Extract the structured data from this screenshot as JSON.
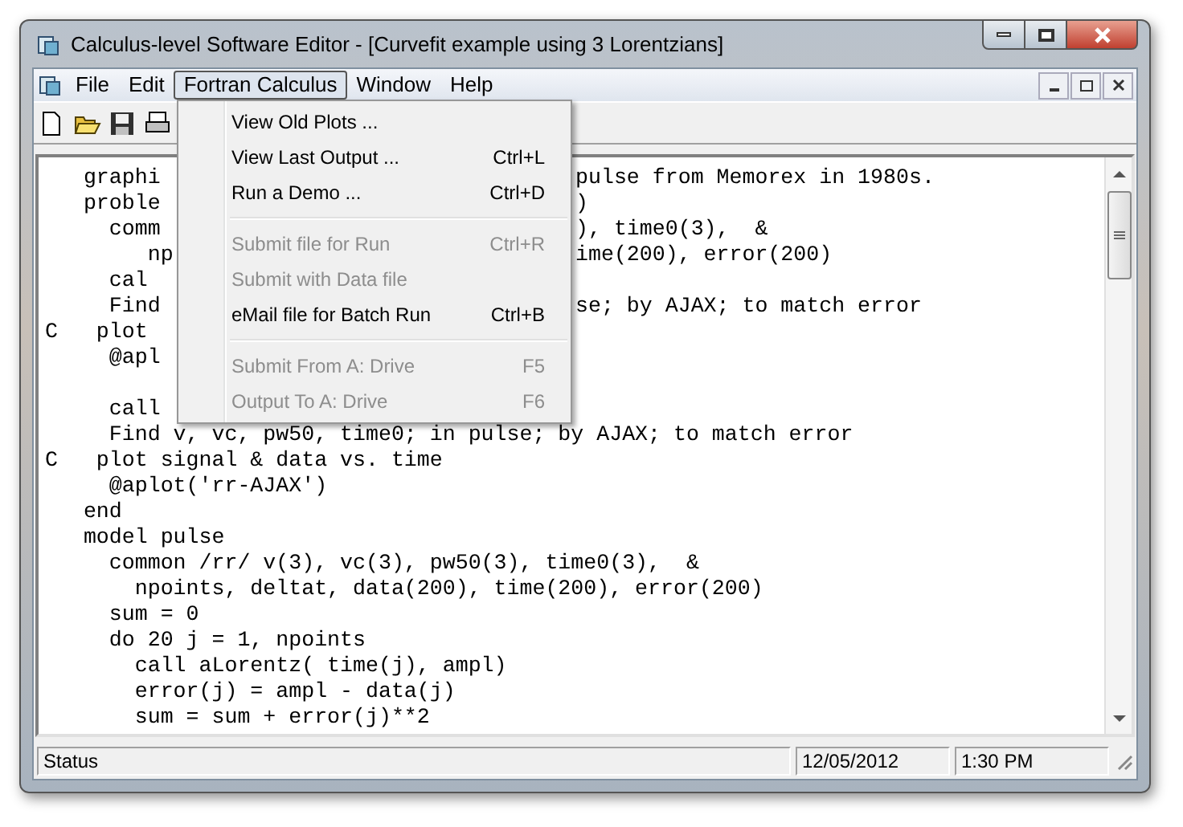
{
  "window": {
    "title": "Calculus-level Software Editor - [Curvefit example using 3 Lorentzians]"
  },
  "menubar": {
    "items": [
      {
        "label": "File",
        "selected": false
      },
      {
        "label": "Edit",
        "selected": false
      },
      {
        "label": "Fortran Calculus",
        "selected": true
      },
      {
        "label": "Window",
        "selected": false
      },
      {
        "label": "Help",
        "selected": false
      }
    ]
  },
  "dropdown": {
    "items": [
      {
        "kind": "item",
        "label": "View Old Plots ...",
        "disabled": false
      },
      {
        "kind": "item",
        "label": "View Last Output ...",
        "shortcut": "Ctrl+L",
        "disabled": false
      },
      {
        "kind": "item",
        "label": "Run a Demo ...",
        "shortcut": "Ctrl+D",
        "disabled": false
      },
      {
        "kind": "separator"
      },
      {
        "kind": "item",
        "label": "Submit file for Run",
        "shortcut": "Ctrl+R",
        "disabled": true
      },
      {
        "kind": "item",
        "label": "Submit with Data file",
        "disabled": true
      },
      {
        "kind": "item",
        "label": "eMail file for Batch Run",
        "shortcut": "Ctrl+B",
        "disabled": false
      },
      {
        "kind": "separator"
      },
      {
        "kind": "item",
        "label": "Submit From A: Drive",
        "shortcut": "F5",
        "disabled": true
      },
      {
        "kind": "item",
        "label": "Output To A: Drive",
        "shortcut": "F6",
        "disabled": true
      }
    ]
  },
  "editor": {
    "lines": [
      {
        "kind": "code",
        "left": "   graphi",
        "right": "pulse from Memorex in 1980s."
      },
      {
        "kind": "code",
        "left": "   proble",
        "right": ")"
      },
      {
        "kind": "code",
        "left": "     comm",
        "right": "), time0(3),  &"
      },
      {
        "kind": "code",
        "left": "        np",
        "right": "ime(200), error(200)"
      },
      {
        "kind": "code",
        "left": "     cal"
      },
      {
        "kind": "code",
        "left": "     Find",
        "right": "se; by AJAX; to match error"
      },
      {
        "kind": "code",
        "left": "C   plot"
      },
      {
        "kind": "code",
        "left": "     @apl"
      },
      {
        "kind": "blank"
      },
      {
        "kind": "code",
        "left": "     call"
      },
      {
        "kind": "code",
        "left": "     Find v, vc, pw50, time0; in pulse; by AJAX; to match error"
      },
      {
        "kind": "code",
        "left": "C   plot signal & data vs. time"
      },
      {
        "kind": "code",
        "left": "     @aplot('rr-AJAX')"
      },
      {
        "kind": "code",
        "left": "   end"
      },
      {
        "kind": "code",
        "left": "   model pulse"
      },
      {
        "kind": "code",
        "left": "     common /rr/ v(3), vc(3), pw50(3), time0(3),  &"
      },
      {
        "kind": "code",
        "left": "       npoints, deltat, data(200), time(200), error(200)"
      },
      {
        "kind": "code",
        "left": "     sum = 0"
      },
      {
        "kind": "code",
        "left": "     do 20 j = 1, npoints"
      },
      {
        "kind": "code",
        "left": "       call aLorentz( time(j), ampl)"
      },
      {
        "kind": "code",
        "left": "       error(j) = ampl - data(j)"
      },
      {
        "kind": "code",
        "left": "       sum = sum + error(j)**2"
      }
    ]
  },
  "status_bar": [
    {
      "text": "Status"
    },
    {
      "text": "12/05/2012"
    },
    {
      "text": "1:30 PM"
    }
  ]
}
